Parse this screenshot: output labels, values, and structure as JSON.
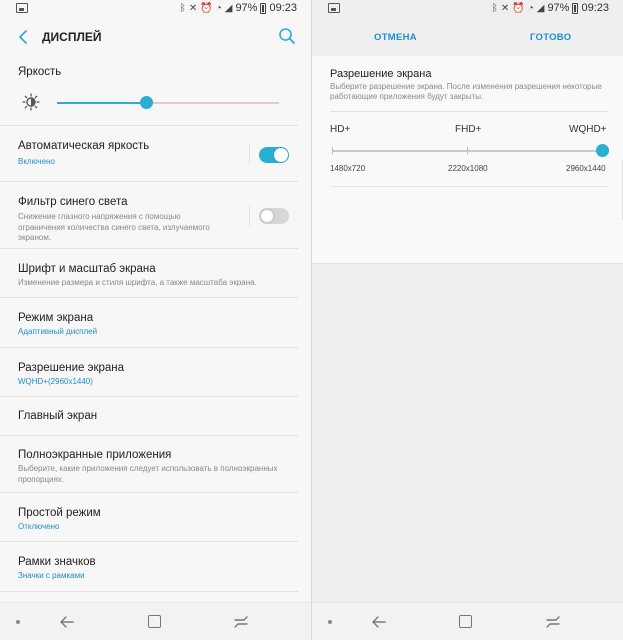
{
  "status_bar": {
    "battery": "97%",
    "time": "09:23"
  },
  "left": {
    "header": {
      "title": "ДИСПЛЕЙ"
    },
    "brightness": {
      "title": "Яркость",
      "level_percent": 40
    },
    "items": [
      {
        "title": "Автоматическая яркость",
        "subtitle": "Включено",
        "toggle": "on"
      },
      {
        "title": "Фильтр синего света",
        "subtitle": "Снижение глазного напряжения с помощью ограничения количества синего света, излучаемого экраном.",
        "toggle": "off"
      },
      {
        "title": "Шрифт и масштаб экрана",
        "subtitle": "Изменение размера и стиля шрифта, а также масштаба экрана."
      },
      {
        "title": "Режим экрана",
        "subtitle": "Адаптивный дисплей"
      },
      {
        "title": "Разрешение экрана",
        "subtitle": "WQHD+(2960x1440)"
      },
      {
        "title": "Главный экран",
        "subtitle": ""
      },
      {
        "title": "Полноэкранные приложения",
        "subtitle": "Выберите, какие приложения следует использовать в полноэкранных пропорциях."
      },
      {
        "title": "Простой режим",
        "subtitle": "Отключено"
      },
      {
        "title": "Рамки значков",
        "subtitle": "Значки с рамками"
      }
    ]
  },
  "right": {
    "cancel_label": "ОТМЕНА",
    "done_label": "ГОТОВО",
    "dialog": {
      "title": "Разрешение экрана",
      "subtitle": "Выберите разрешение экрана. После изменения разрешения некоторые работающие приложения будут закрыты.",
      "options": [
        {
          "label": "HD+",
          "value": "1480x720"
        },
        {
          "label": "FHD+",
          "value": "2220x1080"
        },
        {
          "label": "WQHD+",
          "value": "2960x1440"
        }
      ],
      "selected_index": 2
    }
  },
  "colors": {
    "accent": "#2aaed1",
    "link": "#1e8ecb"
  }
}
